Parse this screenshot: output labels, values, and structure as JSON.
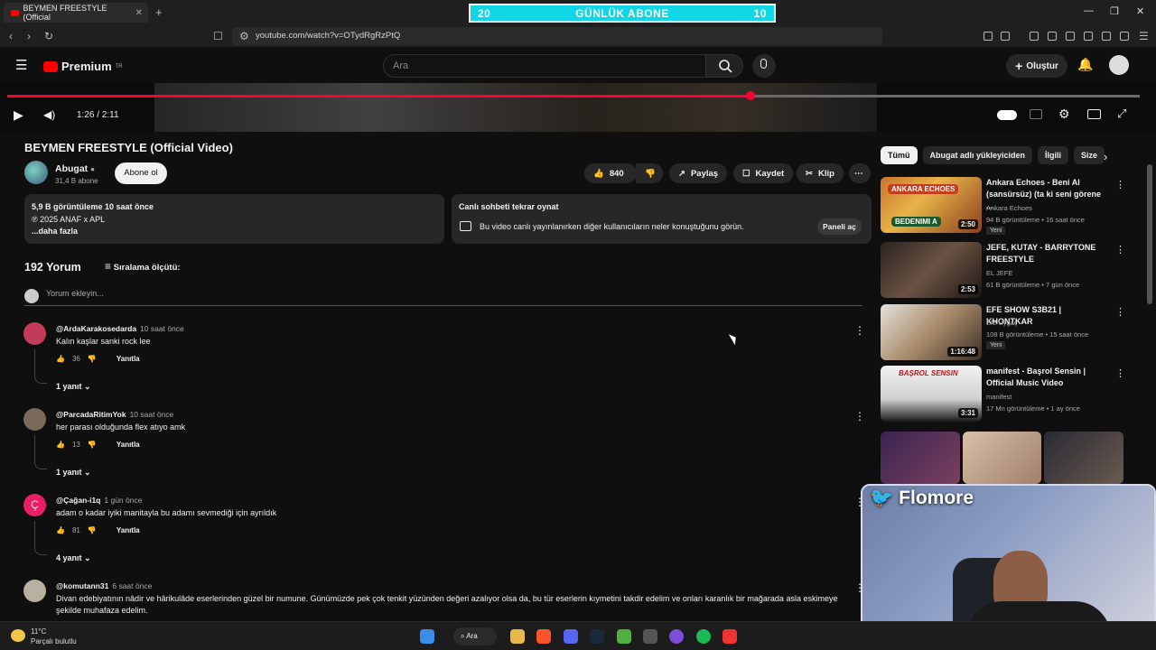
{
  "browser": {
    "tab_title": "BEYMEN FREESTYLE (Official",
    "url": "youtube.com/watch?v=OTydRgRzPtQ"
  },
  "overlay_goal": {
    "left": "20",
    "label": "GÜNLÜK ABONE",
    "right": "10"
  },
  "youtube": {
    "logo_text": "Premium",
    "logo_sup": "TR",
    "search_placeholder": "Ara",
    "create_label": "Oluştur"
  },
  "player": {
    "time": "1:26 / 2:11",
    "progress_fraction": 0.656
  },
  "video": {
    "title": "BEYMEN FREESTYLE (Official Video)",
    "channel": "Abugat",
    "subs": "31,4 B abone",
    "subscribe_label": "Abone ol",
    "likes": "840",
    "share_label": "Paylaş",
    "save_label": "Kaydet",
    "clip_label": "Klip"
  },
  "description": {
    "line1": "5,9 B görüntüleme  10 saat önce",
    "line2": "℗ 2025 ANAF x APL",
    "line3": "...daha fazla"
  },
  "chat_replay": {
    "title": "Canlı sohbeti tekrar oynat",
    "body": "Bu video canlı yayınlanırken diğer kullanıcıların neler konuştuğunu görün.",
    "button": "Paneli aç"
  },
  "comments": {
    "count_label": "192 Yorum",
    "sort_label": "Sıralama ölçütü:",
    "add_placeholder": "Yorum ekleyin...",
    "items": [
      {
        "user": "@ArdaKarakosedarda",
        "when": "10 saat önce",
        "text": "Kalın kaşlar sanki rock lee",
        "likes": "36",
        "reply": "Yanıtla",
        "replies": "1 yanıt",
        "color": "#c23b5a"
      },
      {
        "user": "@ParcadaRitimYok",
        "when": "10 saat önce",
        "text": "her parası olduğunda flex atıyo amk",
        "likes": "13",
        "reply": "Yanıtla",
        "replies": "1 yanıt",
        "color": "#7a6a5c"
      },
      {
        "user": "@Çağan-i1q",
        "when": "1 gün önce",
        "text": "adam o kadar iyiki manitayla bu adamı sevmediği için ayrıldık",
        "likes": "81",
        "reply": "Yanıtla",
        "replies": "4 yanıt",
        "color": "#e91e63",
        "initial": "Ç"
      },
      {
        "user": "@komutann31",
        "when": "6 saat önce",
        "text": "Divan edebiyatının nâdir ve hârikulâde eserlerinden güzel bir numune. Günümüzde pek çok tenkit yüzünden değeri azalıyor olsa da, bu tür eserlerin kıymetini takdir edelim ve onları karanlık bir mağarada asla eskimeye",
        "text2": "şekilde muhafaza edelim.",
        "color": "#b8b0a0"
      }
    ]
  },
  "sidebar": {
    "chips": [
      "Tümü",
      "Abugat adlı yükleyiciden",
      "İlgili",
      "Size"
    ],
    "recs": [
      {
        "title": "Ankara Echoes - Beni Al (sansürsüz) (ta ki seni görene ...",
        "channel": "Ankara Echoes",
        "meta": "94 B görüntüleme  •  16 saat önce",
        "badge": "Yeni",
        "duration": "2:50",
        "thumb_text": "ANKARA ECHOES",
        "thumb_text2": "BEDENIMI A"
      },
      {
        "title": "JEFE, KUTAY - BARRYTONE FREESTYLE",
        "channel": "EL JEFE",
        "meta": "61 B görüntüleme  •  7 gün önce",
        "duration": "2:53"
      },
      {
        "title": "EFE SHOW S3B21 | KHONTKAR",
        "channel": "Efe Uygaç",
        "meta": "108 B görüntüleme  •  15 saat önce",
        "badge": "Yeni",
        "duration": "1:16:48"
      },
      {
        "title": "manifest - Başrol Sensin | Official Music Video",
        "channel": "manifest",
        "meta": "17 Mn görüntüleme  •  1 ay önce",
        "duration": "3:31",
        "thumb_text": "BAŞROL SENSIN"
      }
    ]
  },
  "webcam": {
    "name": "Flomore"
  },
  "taskbar": {
    "temp": "11°C",
    "weather": "Parçalı bulutlu",
    "search": "Ara"
  }
}
